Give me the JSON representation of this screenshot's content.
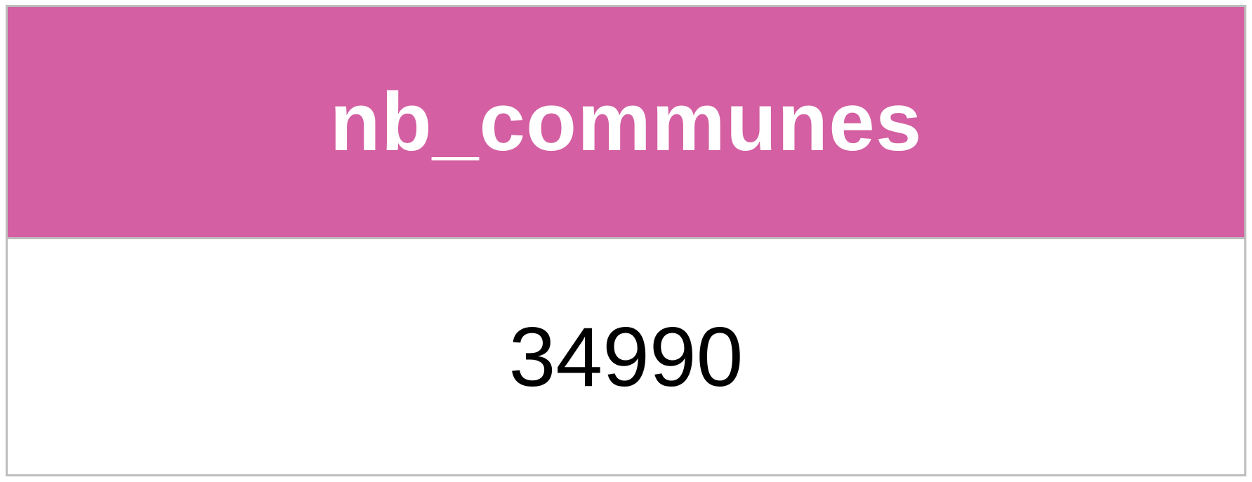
{
  "table": {
    "columns": [
      "nb_communes"
    ],
    "rows": [
      [
        "34990"
      ]
    ],
    "header_label": "nb_communes",
    "value": "34990",
    "colors": {
      "header_background": "#d45fa2",
      "header_text": "#ffffff",
      "border": "#bdbdbd",
      "cell_background": "#ffffff",
      "cell_text": "#000000"
    }
  }
}
